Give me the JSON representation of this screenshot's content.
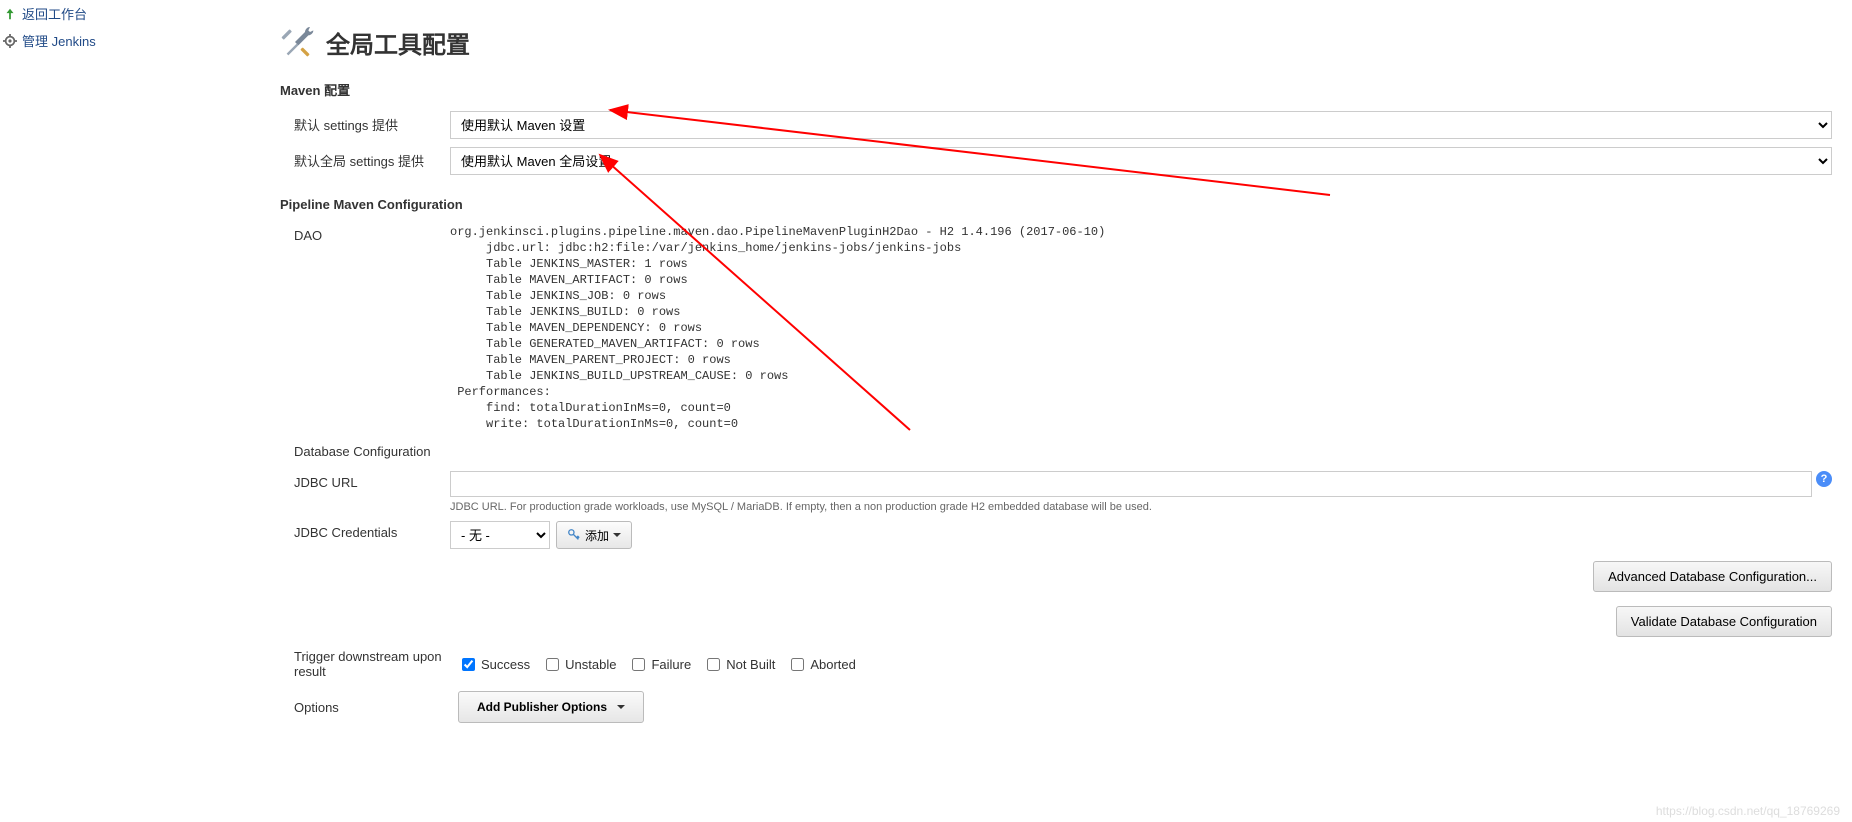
{
  "nav": {
    "back": "返回工作台",
    "manage": "管理 Jenkins"
  },
  "page": {
    "title": "全局工具配置"
  },
  "maven": {
    "section_title": "Maven 配置",
    "settings_label": "默认 settings 提供",
    "settings_value": "使用默认 Maven 设置",
    "global_settings_label": "默认全局 settings 提供",
    "global_settings_value": "使用默认 Maven 全局设置"
  },
  "pipeline": {
    "section_title": "Pipeline Maven Configuration",
    "dao_label": "DAO",
    "dao_text": "org.jenkinsci.plugins.pipeline.maven.dao.PipelineMavenPluginH2Dao - H2 1.4.196 (2017-06-10)\n     jdbc.url: jdbc:h2:file:/var/jenkins_home/jenkins-jobs/jenkins-jobs\n     Table JENKINS_MASTER: 1 rows\n     Table MAVEN_ARTIFACT: 0 rows\n     Table JENKINS_JOB: 0 rows\n     Table JENKINS_BUILD: 0 rows\n     Table MAVEN_DEPENDENCY: 0 rows\n     Table GENERATED_MAVEN_ARTIFACT: 0 rows\n     Table MAVEN_PARENT_PROJECT: 0 rows\n     Table JENKINS_BUILD_UPSTREAM_CAUSE: 0 rows\n Performances:\n     find: totalDurationInMs=0, count=0\n     write: totalDurationInMs=0, count=0",
    "db_config_label": "Database Configuration",
    "jdbc_url_label": "JDBC URL",
    "jdbc_url_value": "",
    "jdbc_url_help": "JDBC URL. For production grade workloads, use MySQL / MariaDB. If empty, then a non production grade H2 embedded database will be used.",
    "jdbc_creds_label": "JDBC Credentials",
    "jdbc_creds_value": "- 无 -",
    "add_btn": "添加",
    "advanced_btn": "Advanced Database Configuration...",
    "validate_btn": "Validate Database Configuration"
  },
  "trigger": {
    "label": "Trigger downstream upon result",
    "success": "Success",
    "unstable": "Unstable",
    "failure": "Failure",
    "not_built": "Not Built",
    "aborted": "Aborted"
  },
  "options": {
    "label": "Options",
    "publisher_btn": "Add Publisher Options"
  },
  "watermark": "https://blog.csdn.net/qq_18769269"
}
